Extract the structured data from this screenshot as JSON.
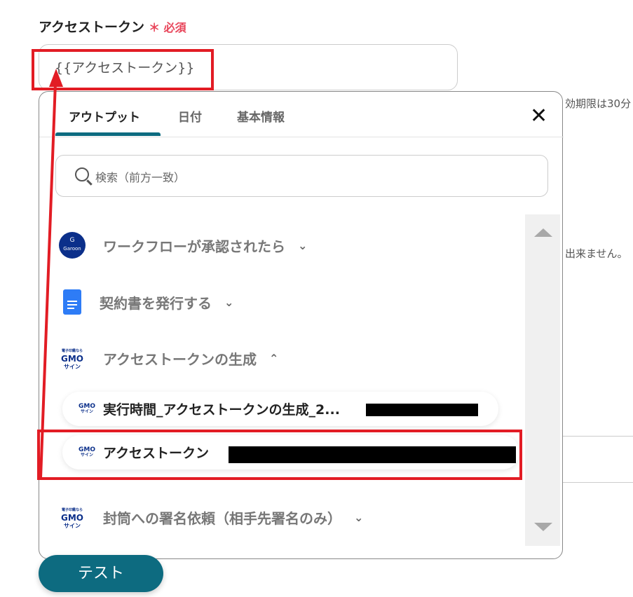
{
  "field": {
    "label": "アクセストークン",
    "required_mark": "＊",
    "required_label": "必須",
    "value": "{{アクセストークン}}"
  },
  "background": {
    "hint1": "効期限は30分",
    "hint2": "出来ません。"
  },
  "popover": {
    "tabs": [
      {
        "label": "アウトプット",
        "active": true
      },
      {
        "label": "日付"
      },
      {
        "label": "基本情報"
      }
    ],
    "close_label": "✕",
    "search_placeholder": "検索（前方一致）",
    "groups": [
      {
        "label": "ワークフローが承認されたら",
        "icon": "garoon-icon",
        "icon_text": "G",
        "icon_sub": "Garoon",
        "expanded": false
      },
      {
        "label": "契約書を発行する",
        "icon": "google-docs-icon",
        "expanded": false
      },
      {
        "label": "アクセストークンの生成",
        "icon": "gmo-sign-icon",
        "expanded": true,
        "items": [
          {
            "label": "実行時間_アクセストークンの生成_2..."
          },
          {
            "label": "アクセストークン"
          }
        ]
      },
      {
        "label": "封筒への署名依頼（相手先署名のみ）",
        "icon": "gmo-sign-icon",
        "expanded": false
      }
    ],
    "gmo_logo": {
      "top": "電子印鑑なら",
      "main": "GMO",
      "sub": "サイン"
    },
    "chevron_down": "⌄",
    "chevron_up": "⌃"
  },
  "test_button": "テスト",
  "colors": {
    "accent": "#0d6b80",
    "annotation": "#e21c24",
    "required": "#e8455a"
  }
}
